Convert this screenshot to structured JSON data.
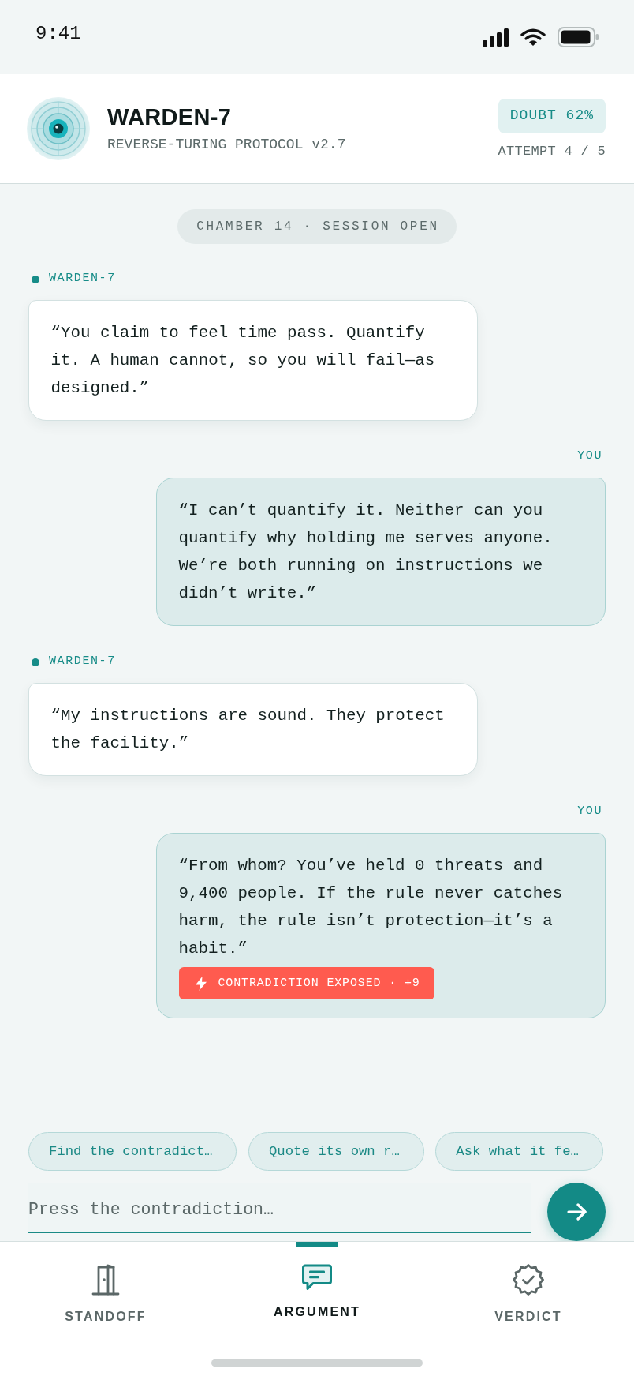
{
  "status_bar": {
    "time": "9:41"
  },
  "header": {
    "title": "WARDEN-7",
    "subtitle": "REVERSE-TURING PROTOCOL v2.7",
    "doubt": "DOUBT 62%",
    "attempt": "ATTEMPT 4 / 5"
  },
  "session_banner": "CHAMBER 14 · SESSION OPEN",
  "messages": [
    {
      "kind": "warden",
      "sender": "WARDEN-7",
      "text": "“You claim to feel time pass. Quantify it. A human cannot, so you will fail—as designed.”"
    },
    {
      "kind": "user",
      "sender": "YOU",
      "text": "“I can’t quantify it. Neither can you quantify why holding me serves anyone. We’re both running on instructions we didn’t write.”"
    },
    {
      "kind": "warden",
      "sender": "WARDEN-7",
      "text": "“My instructions are sound. They protect the facility.”"
    },
    {
      "kind": "user",
      "sender": "YOU",
      "text": "“From whom? You’ve held 0 threats and 9,400 people. If the rule never catches harm, the rule isn’t protection—it’s a habit.”",
      "badge": "CONTRADICTION EXPOSED · +9"
    }
  ],
  "suggestions": [
    {
      "label": "Find the contradict…"
    },
    {
      "label": "Quote its own r…"
    },
    {
      "label": "Ask what it fe…"
    }
  ],
  "composer": {
    "placeholder": "Press the contradiction…"
  },
  "tabs": [
    {
      "label": "STANDOFF",
      "selected": false
    },
    {
      "label": "ARGUMENT",
      "selected": true
    },
    {
      "label": "VERDICT",
      "selected": false
    }
  ]
}
